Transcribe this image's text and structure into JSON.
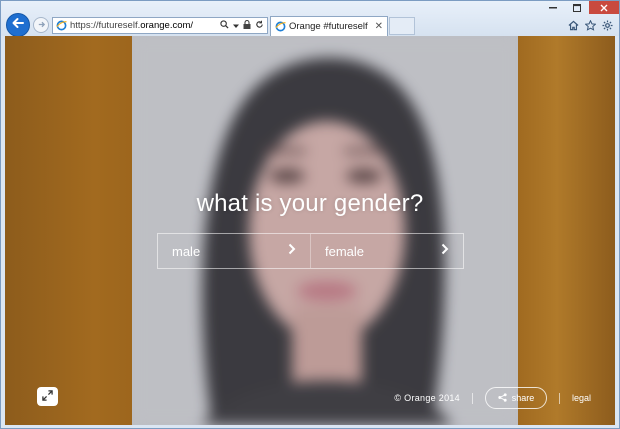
{
  "browser": {
    "url_prefix": "https://futureself.",
    "url_host": "orange.com/",
    "tab_title": "Orange #futureself"
  },
  "page": {
    "question": "what is your gender?",
    "options": [
      {
        "label": "male"
      },
      {
        "label": "female"
      }
    ],
    "footer": {
      "copyright": "© Orange 2014",
      "share_label": "share",
      "legal_label": "legal"
    }
  },
  "colors": {
    "accent": "#1f6fd0",
    "side_panel": "#9d661d"
  },
  "icons": [
    "back-arrow-icon",
    "forward-arrow-icon",
    "ie-icon",
    "search-icon",
    "lock-icon",
    "refresh-icon",
    "home-icon",
    "star-icon",
    "gear-icon",
    "expand-icon",
    "share-icon"
  ]
}
